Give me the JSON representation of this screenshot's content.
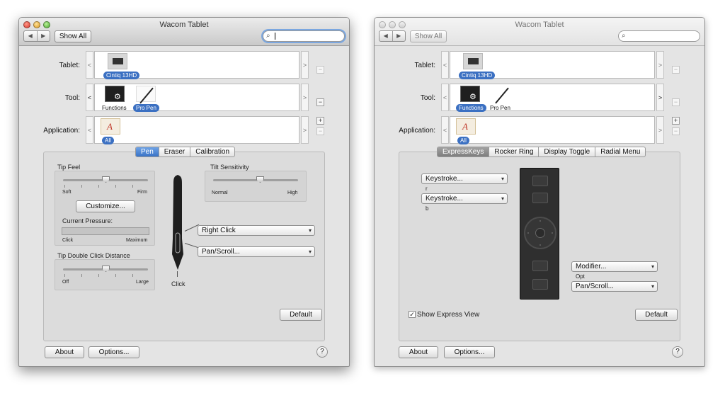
{
  "left_window": {
    "title": "Wacom Tablet",
    "show_all": "Show All",
    "nav_back": "◀",
    "nav_forward": "▶",
    "search_icon": "⌕",
    "tablet_label": "Tablet:",
    "tablet_item": "Cintiq 13HD",
    "tool_label": "Tool:",
    "tool_functions": "Functions",
    "tool_pen": "Pro Pen",
    "application_label": "Application:",
    "app_all": "All",
    "tabs": [
      "Pen",
      "Eraser",
      "Calibration"
    ],
    "active_tab": "Pen",
    "tip_feel": "Tip Feel",
    "soft": "Soft",
    "firm": "Firm",
    "customize": "Customize...",
    "current_pressure": "Current Pressure:",
    "click": "Click",
    "maximum": "Maximum",
    "tip_double_click": "Tip Double Click Distance",
    "off": "Off",
    "large": "Large",
    "tilt_sensitivity": "Tilt Sensitivity",
    "normal": "Normal",
    "high": "High",
    "upper_button": "Right Click",
    "lower_button": "Pan/Scroll...",
    "tip_action": "Click",
    "default_button": "Default",
    "about_button": "About",
    "options_button": "Options...",
    "help": "?",
    "tip_feel_level": 0.5,
    "tilt_level": 0.55,
    "double_click_level": 0.5
  },
  "right_window": {
    "title": "Wacom Tablet",
    "show_all": "Show All",
    "nav_back": "◀",
    "nav_forward": "▶",
    "search_icon": "⌕",
    "tablet_label": "Tablet:",
    "tablet_item": "Cintiq 13HD",
    "tool_label": "Tool:",
    "tool_functions": "Functions",
    "tool_pen": "Pro Pen",
    "application_label": "Application:",
    "app_all": "All",
    "tabs": [
      "ExpressKeys",
      "Rocker Ring",
      "Display Toggle",
      "Radial Menu"
    ],
    "active_tab": "ExpressKeys",
    "key1": "Keystroke...",
    "key1_value": "r",
    "key2": "Keystroke...",
    "key2_value": "b",
    "key3": "Modifier...",
    "key3_value": "Opt",
    "key4": "Pan/Scroll...",
    "show_express_view": "Show Express View",
    "show_express_view_checked": "✓",
    "default_button": "Default",
    "about_button": "About",
    "options_button": "Options...",
    "help": "?"
  },
  "colors": {
    "selection_blue": "#3b70c2",
    "active_tab_blue": "#3973c6",
    "inactive_tab_gray": "#8e8e8e"
  }
}
